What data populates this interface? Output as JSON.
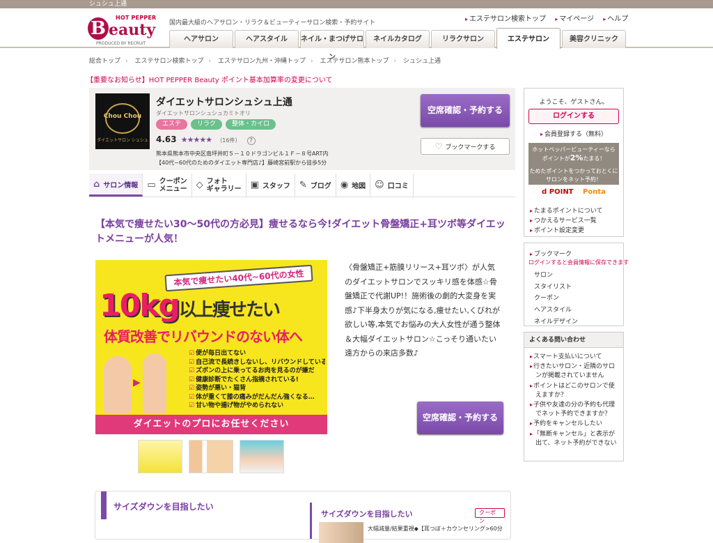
{
  "top_strip": {
    "text": "シュシュ上通"
  },
  "header": {
    "logo_top": "HOT PEPPER",
    "logo_b": "B",
    "logo_main": "eauty",
    "logo_produced": "PRODUCED BY RECRUIT",
    "tagline": "国内最大級のヘアサロン・リラク＆ビューティーサロン検索・予約サイト",
    "util_links": [
      "エステサロン検索トップ",
      "マイページ",
      "ヘルプ"
    ],
    "nav_tabs": [
      "ヘアサロン",
      "ヘアスタイル",
      "ネイル・まつげサロン",
      "ネイルカタログ",
      "リラクサロン",
      "エステサロン",
      "美容クリニック"
    ]
  },
  "breadcrumb": [
    "総合トップ",
    "エステサロン検索トップ",
    "エステサロン九州・沖縄トップ",
    "エステサロン熊本トップ",
    "シュシュ上通"
  ],
  "notice": "【重要なお知らせ】HOT PEPPER Beauty ポイント基本加算率の変更について",
  "salon": {
    "thumb_title": "Chou Chou",
    "thumb_sub": "ダイエットサロン シュシュ",
    "name": "ダイエットサロンシュシュ上通",
    "kana": "ダイエットサロンシュシュカミトオリ",
    "tags": [
      "エステ",
      "リラク",
      "整体・カイロ"
    ],
    "rating": "4.63",
    "stars": "★★★★★",
    "review_count": "（16件）",
    "help": "?",
    "address": "熊本県熊本市中央区南坪井町５－１０ドラゴンビル１Ｆ－８号ART内",
    "access": "【40代~60代のためのダイエット専門店♪】藤崎宮前駅から徒歩5分",
    "reserve_label": "空席確認・予約する",
    "bookmark_label": "ブックマークする"
  },
  "sub_tabs": [
    {
      "icon": "⌂",
      "label": "サロン情報"
    },
    {
      "icon": "▭",
      "label": "クーポン\nメニュー"
    },
    {
      "icon": "◇",
      "label": "フォト\nギャラリー"
    },
    {
      "icon": "▣",
      "label": "スタッフ"
    },
    {
      "icon": "✎",
      "label": "ブログ"
    },
    {
      "icon": "◉",
      "label": "地図"
    },
    {
      "icon": "☺",
      "label": "口コミ"
    }
  ],
  "main": {
    "headline": "【本気で痩せたい30～50代の方必見】痩せるなら今!ダイエット骨盤矯正+耳ツボ等ダイエットメニューが人気！",
    "image": {
      "badge": "本気で痩せたい40代~60代の女性",
      "big_num": "10kg",
      "big_text": "以上痩せたい",
      "sub": "体質改善でリバウンドのない体へ",
      "checks": [
        "便が毎日出てない",
        "自己流で長続きしないし、リバウンドしている",
        "ズボンの上に乗ってるお肉を見るのが嫌だ",
        "健康診断でたくさん指摘されている!",
        "姿勢が悪い・猫背",
        "体が重くて膝の痛みがだんだん強くなる…",
        "甘い物や揚げ物がやめられない"
      ],
      "bottom": "ダイエットのプロにお任せください"
    },
    "description": "〈骨盤矯正+筋膜リリース+耳ツボ〉が人気のダイエットサロンでスッキリ感を体感☆骨盤矯正で代謝UP!！施術後の劇的大変身を実感♪下半身太りが気になる,痩せたい,くびれが欲しい等,本気でお悩みの大人女性が通う整体＆大幅ダイエットサロン☆こっそり通いたい遠方からの来店多数♪",
    "reserve_label": "空席確認・予約する",
    "feature_title": "サイズダウンを目指したい",
    "feature_card_title": "サイズダウンを目指したい",
    "feature_card_badge": "クーポン",
    "feature_card_text": "大幅減量/結果重視◆【耳つぼ＋カウンセリング>60分"
  },
  "sidebar": {
    "welcome": "ようこそ、ゲストさん。",
    "login": "ログインする",
    "register": "会員登録する（無料）",
    "point_banner_1": "ホットペッパービューティーなら",
    "point_banner_2a": "ポイントが",
    "point_banner_pct": "2%",
    "point_banner_2b": "たまる！",
    "point_banner_3": "ためたポイントをつかっておとくにサロンをネット予約！",
    "dpoint": "d POINT",
    "ponta": "Ponta",
    "point_links": [
      "たまるポイントについて",
      "つかえるサービス一覧",
      "ポイント設定変更"
    ],
    "bookmark_heading": "ブックマーク",
    "bookmark_note": "ログインすると会員情報に保存できます",
    "bookmark_items": [
      "サロン",
      "スタイリスト",
      "クーポン",
      "ヘアスタイル",
      "ネイルデザイン"
    ],
    "faq_heading": "よくある問い合わせ",
    "faq_items": [
      "スマート支払いについて",
      "行きたいサロン・近隣のサロンが掲載されていません",
      "ポイントはどこのサロンで使えますか？",
      "子供や友達の分の予約も代理でネット予約できますか？",
      "予約をキャンセルしたい",
      "「無断キャンセル」と表示が出て、ネット予約ができない"
    ]
  }
}
